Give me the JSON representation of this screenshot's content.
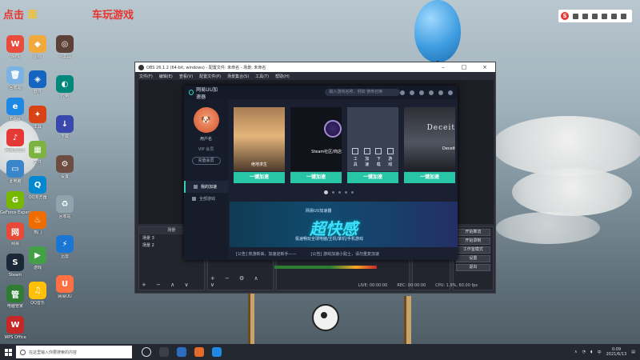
{
  "watermark": {
    "text_a": "点击",
    "text_b": "車",
    "text_c": "车玩游戏"
  },
  "desktop_icons": [
    {
      "label": "WPS",
      "color": "#e74c3c",
      "glyph": "W"
    },
    {
      "label": "回收站",
      "color": "#7ab3e2",
      "glyph": "🗑"
    },
    {
      "label": "Edge",
      "color": "#1e88e5",
      "glyph": "e"
    },
    {
      "label": "网易云音乐",
      "color": "#e53935",
      "glyph": "♪"
    },
    {
      "label": "此电脑",
      "color": "#3a86c8",
      "glyph": "▭"
    },
    {
      "label": "GeForce Experience",
      "color": "#76b900",
      "glyph": "G"
    },
    {
      "label": "网易",
      "color": "#e84a3a",
      "glyph": "网"
    },
    {
      "label": "Steam",
      "color": "#1b2838",
      "glyph": "S"
    },
    {
      "label": "电脑管家",
      "color": "#2e7d32",
      "glyph": "管"
    },
    {
      "label": "WPS Office",
      "color": "#c62828",
      "glyph": "W"
    }
  ],
  "desktop_icons_col2": [
    {
      "label": "图标",
      "color": "#f2a93b",
      "glyph": "◆"
    },
    {
      "label": "软件",
      "color": "#1565c0",
      "glyph": "◈"
    },
    {
      "label": "工具",
      "color": "#d84315",
      "glyph": "✦"
    },
    {
      "label": "文件",
      "color": "#7cb342",
      "glyph": "▦"
    },
    {
      "label": "QQ浏览器",
      "color": "#0288d1",
      "glyph": "Q"
    },
    {
      "label": "热门",
      "color": "#ef6c00",
      "glyph": "♨"
    },
    {
      "label": "游戏",
      "color": "#43a047",
      "glyph": "▶"
    },
    {
      "label": "QQ音乐",
      "color": "#ffc107",
      "glyph": "♫"
    }
  ],
  "desktop_icons_col3": [
    {
      "label": "小工具",
      "color": "#5d4037",
      "glyph": "◎"
    },
    {
      "label": "应用",
      "color": "#00897b",
      "glyph": "◐"
    },
    {
      "label": "下载",
      "color": "#3949ab",
      "glyph": "↓"
    },
    {
      "label": "设置",
      "color": "#6d4c41",
      "glyph": "⚙"
    },
    {
      "label": "回收站",
      "color": "#90a4ae",
      "glyph": "♻"
    },
    {
      "label": "迅雷",
      "color": "#1976d2",
      "glyph": "⚡"
    },
    {
      "label": "网易UU",
      "color": "#ff7043",
      "glyph": "U"
    }
  ],
  "obs": {
    "title": "OBS 26.1.2 (64-bit, windows) - 配置文件: 未命名 - 场景: 未命名",
    "menu": [
      "文件(F)",
      "编辑(E)",
      "查看(V)",
      "配置文件(P)",
      "场景集合(S)",
      "工具(T)",
      "帮助(H)"
    ],
    "scenes_header": "场景",
    "scenes": [
      "场景 3",
      "场景 2"
    ],
    "controls": [
      "开始推流",
      "开始录制",
      "工作室模式",
      "设置",
      "退出"
    ],
    "status": [
      "LIVE: 00:00:00",
      "REC: 00:00:00",
      "CPU: 1.9%, 60.00 fps"
    ]
  },
  "uu": {
    "brand": "网易UU加速器",
    "search_placeholder": "输入游戏名称，例如 使命召唤",
    "username": "用户名",
    "vip": "VIP 会员",
    "vip_button": "充值会员",
    "nav": [
      {
        "label": "我的加速",
        "active": true
      },
      {
        "label": "全部游戏",
        "active": false
      }
    ],
    "cards": [
      {
        "name": "绝地求生",
        "type": "pubg",
        "button": "一键加速"
      },
      {
        "name": "Steam社区/商店",
        "type": "steam",
        "button": "一键加速"
      },
      {
        "name": "",
        "type": "tools",
        "button": "一键加速"
      },
      {
        "name": "Deceit",
        "type": "deceit",
        "button": "一键加速"
      }
    ],
    "tools": [
      "工具",
      "加速",
      "下载",
      "游戏"
    ],
    "banner_logo": "网易UU加速器",
    "banner_title": "超快感",
    "banner_sub": "极速畅玩全球电脑/主机/掌机/手机游戏",
    "notice_1": "[公告] 热游新来，加速迎新手——",
    "notice_2": "[公告] 游戏加速小贴士，请勿重复加速"
  },
  "taskbar": {
    "search": "在这里输入你要搜索的内容",
    "time": "0:09",
    "date": "2021/6/13",
    "lang": "中"
  }
}
